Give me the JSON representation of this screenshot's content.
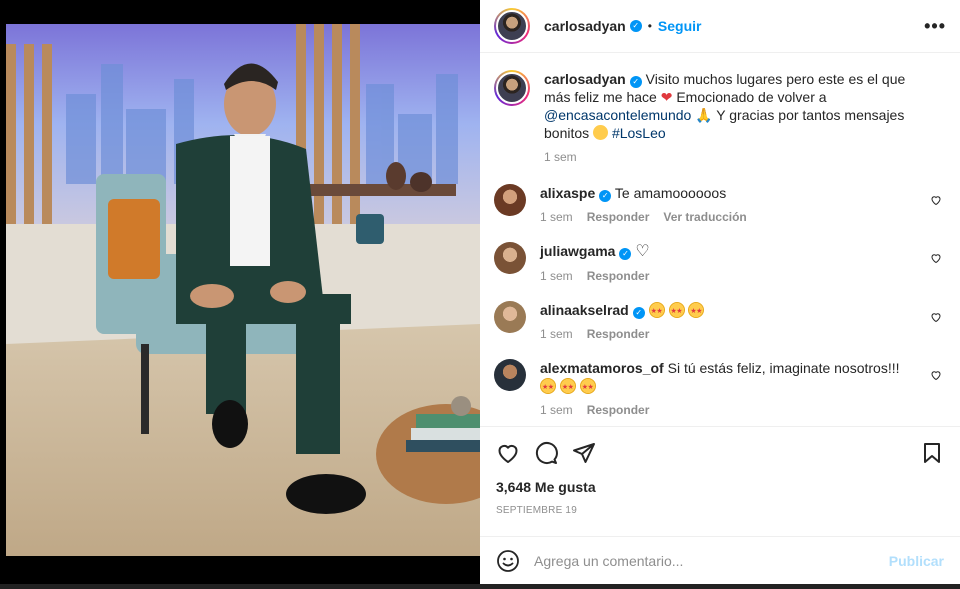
{
  "header": {
    "username": "carlosadyan",
    "separator": "•",
    "follow_label": "Seguir",
    "more_label": "•••"
  },
  "caption": {
    "username": "carlosadyan",
    "text_1": "Visito muchos lugares pero este es el que más feliz me hace",
    "text_2": "Emocionado de volver a",
    "mention": "@encasacontelemundo",
    "text_3": "Y gracias por tantos mensajes bonitos",
    "hashtag": "#LosLeo",
    "time": "1 sem"
  },
  "comments": [
    {
      "username": "alixaspe",
      "text": "Te amamoooooos",
      "time": "1 sem",
      "reply": "Responder",
      "translate": "Ver traducción"
    },
    {
      "username": "juliawgama",
      "text": "♡",
      "time": "1 sem",
      "reply": "Responder"
    },
    {
      "username": "alinaakselrad",
      "text": "",
      "time": "1 sem",
      "reply": "Responder"
    },
    {
      "username": "alexmatamoros_of",
      "text": "Si tú estás feliz, imaginate nosotros!!!",
      "time": "1 sem",
      "reply": "Responder"
    }
  ],
  "likes": "3,648 Me gusta",
  "date": "SEPTIEMBRE 19",
  "comment_input": {
    "placeholder": "Agrega un comentario...",
    "publish": "Publicar"
  },
  "icons": [
    "heart-icon",
    "comment-icon",
    "share-icon",
    "bookmark-icon",
    "emoji-icon",
    "verified-icon",
    "more-icon"
  ],
  "colors": {
    "accent": "#0095f6",
    "text": "#262626",
    "muted": "#8e8e8e",
    "publish_disabled": "#b2dffc",
    "heart_red": "#e0393e"
  }
}
